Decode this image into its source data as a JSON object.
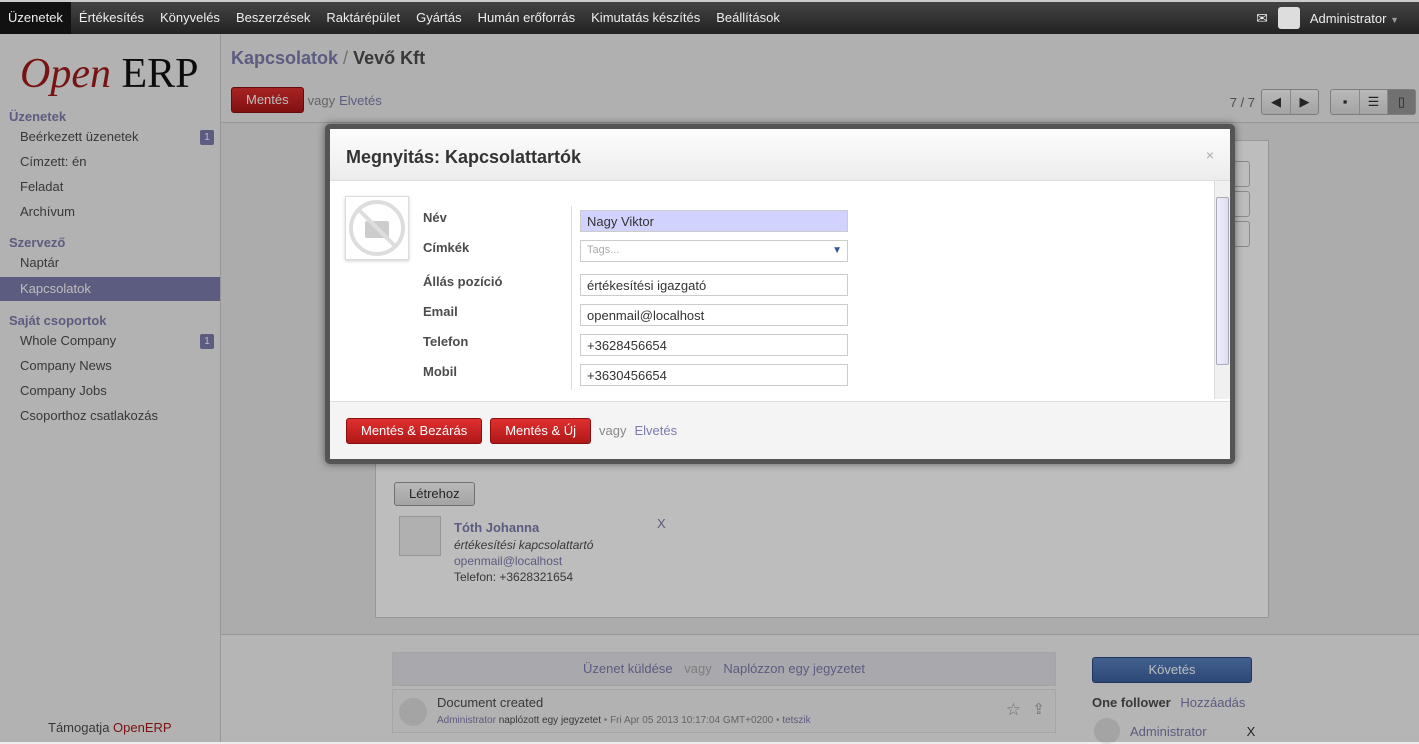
{
  "topbar": {
    "menus": [
      "Üzenetek",
      "Értékesítés",
      "Könyvelés",
      "Beszerzések",
      "Raktárépület",
      "Gyártás",
      "Humán erőforrás",
      "Kimutatás készítés",
      "Beállítások"
    ],
    "user": "Administrator",
    "mail_icon": "envelope-icon"
  },
  "logo": {
    "open": "Open",
    "erp": "ERP"
  },
  "sidebar": {
    "sections": [
      {
        "title": "Üzenetek",
        "items": [
          {
            "label": "Beérkezett üzenetek",
            "badge": "1"
          },
          {
            "label": "Címzett: én"
          },
          {
            "label": "Feladat"
          },
          {
            "label": "Archívum"
          }
        ]
      },
      {
        "title": "Szervező",
        "items": [
          {
            "label": "Naptár"
          },
          {
            "label": "Kapcsolatok",
            "selected": true
          }
        ]
      },
      {
        "title": "Saját csoportok",
        "items": [
          {
            "label": "Whole Company",
            "badge": "1"
          },
          {
            "label": "Company News"
          },
          {
            "label": "Company Jobs"
          },
          {
            "label": "Csoporthoz csatlakozás"
          }
        ]
      }
    ],
    "support_prefix": "Támogatja",
    "support_brand": "OpenERP"
  },
  "header": {
    "breadcrumb_parent": "Kapcsolatok",
    "breadcrumb_sep": " / ",
    "breadcrumb_current": "Vevő Kft",
    "save": "Mentés",
    "or": "vagy",
    "discard": "Elvetés",
    "pager": "7 / 7"
  },
  "contacts": {
    "create": "Létrehoz",
    "card": {
      "name": "Tóth Johanna",
      "function": "értékesítési kapcsolattartó",
      "email": "openmail@localhost",
      "phone": "Telefon: +3628321654",
      "remove": "X"
    }
  },
  "chatter": {
    "send": "Üzenet küldése",
    "or": "vagy",
    "log": "Naplózzon egy jegyzetet",
    "message_title": "Document created",
    "message_author": "Administrator",
    "message_action": "naplózott egy jegyzetet",
    "message_date": "Fri Apr 05 2013 10:17:04 GMT+0200",
    "message_like": "tetszik",
    "sep": "•",
    "follow": "Követés",
    "followers": "One follower",
    "add": "Hozzáadás",
    "follower_name": "Administrator",
    "follower_remove": "X"
  },
  "modal": {
    "title": "Megnyitás: Kapcsolattartók",
    "close": "×",
    "fields": [
      {
        "label": "Név",
        "value": "Nagy Viktor"
      },
      {
        "label": "Címkék",
        "placeholder": "Tags..."
      },
      {
        "label": "Állás pozíció",
        "value": "értékesítési igazgató"
      },
      {
        "label": "Email",
        "value": "openmail@localhost"
      },
      {
        "label": "Telefon",
        "value": "+3628456654"
      },
      {
        "label": "Mobil",
        "value": "+3630456654"
      }
    ],
    "save_close": "Mentés & Bezárás",
    "save_new": "Mentés & Új",
    "or": "vagy",
    "discard": "Elvetés"
  }
}
